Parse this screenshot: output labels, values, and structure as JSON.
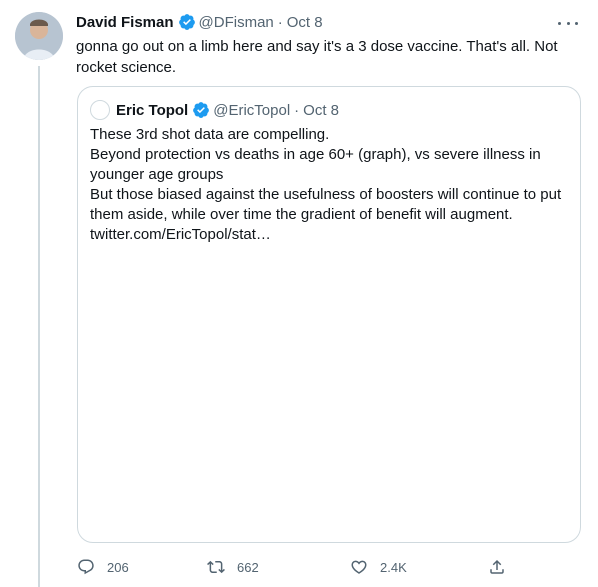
{
  "tweet": {
    "author_name": "David Fisman",
    "handle": "@DFisman",
    "separator": "·",
    "date": "Oct 8",
    "text": "gonna go out on a limb here and say it's a 3 dose vaccine.  That's all.  Not rocket science."
  },
  "quote": {
    "author_name": "Eric Topol",
    "handle": "@EricTopol",
    "separator": "·",
    "date": "Oct 8",
    "lines": [
      "These 3rd shot data are compelling.",
      "Beyond protection vs deaths in age 60+ (graph), vs severe illness in",
      "younger age groups",
      "But those biased against the usefulness of boosters will continue to put",
      "them aside, while over time the gradient of benefit will augment.",
      "twitter.com/EricTopol/stat…"
    ]
  },
  "actions": {
    "replies": "206",
    "retweets": "662",
    "likes": "2.4K"
  },
  "colors": {
    "verified": "#1d9bf0",
    "secondary_text": "#536471",
    "border": "#cfd9de"
  },
  "icons": [
    "verified-badge-icon",
    "more-icon",
    "reply-icon",
    "retweet-icon",
    "like-icon",
    "share-icon"
  ]
}
